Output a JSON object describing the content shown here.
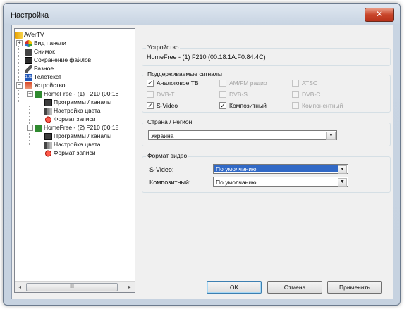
{
  "window": {
    "title": "Настройка",
    "close_glyph": "✕"
  },
  "tree": {
    "items": [
      {
        "label": "AVerTV",
        "icon": "averTV-logo-icon"
      },
      {
        "label": "Вид панели",
        "icon": "panel-view-icon"
      },
      {
        "label": "Снимок",
        "icon": "camera-icon"
      },
      {
        "label": "Сохранение файлов",
        "icon": "floppy-disk-icon"
      },
      {
        "label": "Разное",
        "icon": "pencil-icon"
      },
      {
        "label": "Телетекст",
        "icon": "teletext-icon"
      },
      {
        "label": "Устройство",
        "icon": "device-icon"
      },
      {
        "label": "HomeFree - (1) F210 (00:18",
        "icon": "tuner-card-icon"
      },
      {
        "label": "Программы / каналы",
        "icon": "monitor-icon"
      },
      {
        "label": "Настройка цвета",
        "icon": "color-bars-icon"
      },
      {
        "label": "Формат записи",
        "icon": "record-icon"
      },
      {
        "label": "HomeFree - (2) F210 (00:18",
        "icon": "tuner-card-icon"
      },
      {
        "label": "Программы / каналы",
        "icon": "monitor-icon"
      },
      {
        "label": "Настройка цвета",
        "icon": "color-bars-icon"
      },
      {
        "label": "Формат записи",
        "icon": "record-icon"
      }
    ],
    "scroll_thumb": "III",
    "left_arrow": "◂",
    "right_arrow": "▸"
  },
  "device": {
    "title": "Устройство",
    "value": "HomeFree - (1) F210 (00:18:1A:F0:84:4C)"
  },
  "signals": {
    "title": "Поддерживаемые сигналы",
    "checkboxes": [
      {
        "label": "Аналоговое ТВ",
        "checked": true,
        "enabled": true
      },
      {
        "label": "AM/FM радио",
        "checked": false,
        "enabled": false
      },
      {
        "label": "ATSC",
        "checked": false,
        "enabled": false
      },
      {
        "label": "DVB-T",
        "checked": false,
        "enabled": false
      },
      {
        "label": "DVB-S",
        "checked": false,
        "enabled": false
      },
      {
        "label": "DVB-C",
        "checked": false,
        "enabled": false
      },
      {
        "label": "S-Video",
        "checked": true,
        "enabled": true
      },
      {
        "label": "Композитный",
        "checked": true,
        "enabled": true
      },
      {
        "label": "Компонентный",
        "checked": false,
        "enabled": false
      }
    ],
    "check_glyph": "✓"
  },
  "region": {
    "title": "Страна / Регион",
    "value": "Украина"
  },
  "video_format": {
    "title": "Формат видео",
    "svideo_label": "S-Video:",
    "svideo_value": "По умолчанию",
    "composite_label": "Композитный:",
    "composite_value": "По умолчанию"
  },
  "dropdown_arrow": "▼",
  "buttons": {
    "ok": "OK",
    "cancel": "Отмена",
    "apply": "Применить"
  },
  "colors": {
    "selection": "#3169c6",
    "title_gradient_top": "#dfe7f1",
    "close_red": "#c8452a"
  }
}
